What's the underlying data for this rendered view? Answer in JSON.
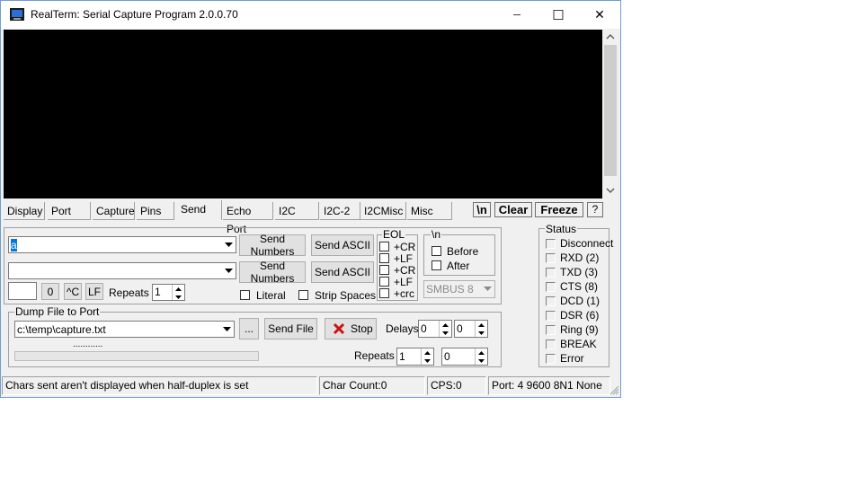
{
  "window": {
    "title": "RealTerm: Serial Capture Program 2.0.0.70",
    "minimize_glyph": "─",
    "maximize_glyph": "☐",
    "close_glyph": "✕"
  },
  "tabs": [
    "Display",
    "Port",
    "Capture",
    "Pins",
    "Send",
    "Echo Port",
    "I2C",
    "I2C-2",
    "I2CMisc",
    "Misc"
  ],
  "active_tab": "Send",
  "toolbar": {
    "newline_label": "\\n",
    "clear_label": "Clear",
    "freeze_label": "Freeze",
    "help_label": "?"
  },
  "send": {
    "line1_value": "a",
    "line2_value": "",
    "send_numbers_1": "Send Numbers",
    "send_ascii_1": "Send ASCII",
    "send_numbers_2": "Send Numbers",
    "send_ascii_2": "Send ASCII",
    "small_edit_value": "",
    "zero_label": "0",
    "ctrl_c_label": "^C",
    "lf_label": "LF",
    "repeats_label": "Repeats",
    "repeats_value": "1",
    "literal_label": "Literal",
    "strip_spaces_label": "Strip Spaces"
  },
  "eol": {
    "title": "EOL",
    "items": [
      "+CR",
      "+LF",
      "+CR",
      "+LF",
      "+crc"
    ]
  },
  "newline_group": {
    "title": "\\n",
    "before_label": "Before",
    "after_label": "After",
    "smbus_value": "SMBUS 8"
  },
  "dump": {
    "title": "Dump File to Port",
    "file_path": "c:\\temp\\capture.txt",
    "browse_label": "...",
    "send_file_label": "Send File",
    "stop_label": "Stop",
    "delays_label": "Delays",
    "delay1_value": "0",
    "delay2_value": "0",
    "repeats_label": "Repeats",
    "repeats1_value": "1",
    "repeats2_value": "0",
    "progress_dots": "............",
    "progress": 0
  },
  "status_group": {
    "title": "Status",
    "items": [
      "Disconnect",
      "RXD (2)",
      "TXD (3)",
      "CTS (8)",
      "DCD (1)",
      "DSR (6)",
      "Ring (9)",
      "BREAK",
      "Error"
    ]
  },
  "statusbar": {
    "message": "Chars sent aren't displayed when half-duplex is set",
    "char_count": "Char Count:0",
    "cps": "CPS:0",
    "port": "Port: 4 9600 8N1 None"
  }
}
